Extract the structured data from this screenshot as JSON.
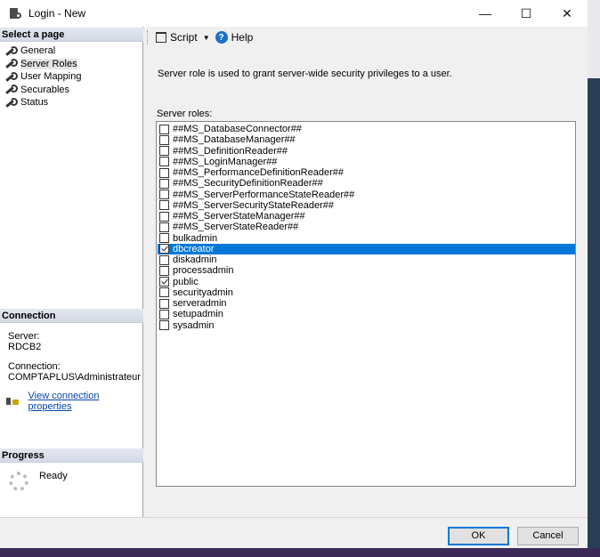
{
  "window": {
    "title": "Login - New",
    "controls": {
      "minimize": "—",
      "maximize": "☐",
      "close": "✕"
    }
  },
  "select_page": {
    "header": "Select a page",
    "items": [
      {
        "label": "General",
        "selected": false
      },
      {
        "label": "Server Roles",
        "selected": true
      },
      {
        "label": "User Mapping",
        "selected": false
      },
      {
        "label": "Securables",
        "selected": false
      },
      {
        "label": "Status",
        "selected": false
      }
    ]
  },
  "connection": {
    "header": "Connection",
    "server_label": "Server:",
    "server_value": "RDCB2",
    "connection_label": "Connection:",
    "connection_value": "COMPTAPLUS\\Administrateur",
    "link": "View connection properties"
  },
  "progress": {
    "header": "Progress",
    "status": "Ready"
  },
  "toolbar": {
    "script_label": "Script",
    "script_arrow": "▼",
    "help_label": "Help",
    "help_glyph": "?"
  },
  "main": {
    "description": "Server role is used to grant server-wide security privileges to a user.",
    "roles_label": "Server roles:",
    "roles": [
      {
        "name": "##MS_DatabaseConnector##",
        "checked": false,
        "selected": false
      },
      {
        "name": "##MS_DatabaseManager##",
        "checked": false,
        "selected": false
      },
      {
        "name": "##MS_DefinitionReader##",
        "checked": false,
        "selected": false
      },
      {
        "name": "##MS_LoginManager##",
        "checked": false,
        "selected": false
      },
      {
        "name": "##MS_PerformanceDefinitionReader##",
        "checked": false,
        "selected": false
      },
      {
        "name": "##MS_SecurityDefinitionReader##",
        "checked": false,
        "selected": false
      },
      {
        "name": "##MS_ServerPerformanceStateReader##",
        "checked": false,
        "selected": false
      },
      {
        "name": "##MS_ServerSecurityStateReader##",
        "checked": false,
        "selected": false
      },
      {
        "name": "##MS_ServerStateManager##",
        "checked": false,
        "selected": false
      },
      {
        "name": "##MS_ServerStateReader##",
        "checked": false,
        "selected": false
      },
      {
        "name": "bulkadmin",
        "checked": false,
        "selected": false
      },
      {
        "name": "dbcreator",
        "checked": true,
        "selected": true
      },
      {
        "name": "diskadmin",
        "checked": false,
        "selected": false
      },
      {
        "name": "processadmin",
        "checked": false,
        "selected": false
      },
      {
        "name": "public",
        "checked": true,
        "selected": false
      },
      {
        "name": "securityadmin",
        "checked": false,
        "selected": false
      },
      {
        "name": "serveradmin",
        "checked": false,
        "selected": false
      },
      {
        "name": "setupadmin",
        "checked": false,
        "selected": false
      },
      {
        "name": "sysadmin",
        "checked": false,
        "selected": false
      }
    ]
  },
  "footer": {
    "ok_label": "OK",
    "cancel_label": "Cancel"
  },
  "colors": {
    "selection": "#0078d7",
    "link": "#0645ad"
  }
}
